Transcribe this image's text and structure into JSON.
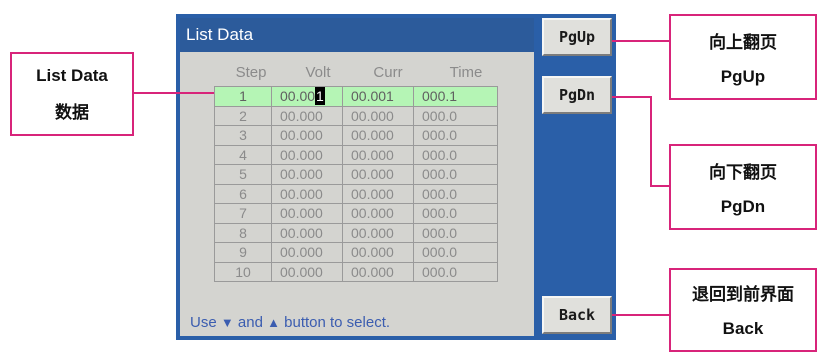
{
  "screen": {
    "title": "List Data",
    "headers": [
      "Step",
      "Volt",
      "Curr",
      "Time"
    ],
    "rows": [
      {
        "step": "1",
        "volt_a": "00.00",
        "volt_cursor": "1",
        "curr": "00.001",
        "time": "000.1"
      },
      {
        "step": "2",
        "volt": "00.000",
        "curr": "00.000",
        "time": "000.0"
      },
      {
        "step": "3",
        "volt": "00.000",
        "curr": "00.000",
        "time": "000.0"
      },
      {
        "step": "4",
        "volt": "00.000",
        "curr": "00.000",
        "time": "000.0"
      },
      {
        "step": "5",
        "volt": "00.000",
        "curr": "00.000",
        "time": "000.0"
      },
      {
        "step": "6",
        "volt": "00.000",
        "curr": "00.000",
        "time": "000.0"
      },
      {
        "step": "7",
        "volt": "00.000",
        "curr": "00.000",
        "time": "000.0"
      },
      {
        "step": "8",
        "volt": "00.000",
        "curr": "00.000",
        "time": "000.0"
      },
      {
        "step": "9",
        "volt": "00.000",
        "curr": "00.000",
        "time": "000.0"
      },
      {
        "step": "10",
        "volt": "00.000",
        "curr": "00.000",
        "time": "000.0"
      }
    ],
    "hint_pre": "Use ",
    "hint_mid": " and ",
    "hint_post": " button to select.",
    "hint_down_icon": "chevron-down-icon",
    "hint_up_icon": "chevron-up-icon"
  },
  "buttons": {
    "pgup": "PgUp",
    "pgdn": "PgDn",
    "back": "Back"
  },
  "callouts": {
    "list_data": {
      "line1": "List Data",
      "line2": "数据"
    },
    "pgup": {
      "line1": "向上翻页",
      "line2": "PgUp"
    },
    "pgdn": {
      "line1": "向下翻页",
      "line2": "PgDn"
    },
    "back": {
      "line1": "退回到前界面",
      "line2": "Back"
    }
  },
  "colors": {
    "callout_border": "#d8247a",
    "screen_blue": "#2a5fa8",
    "active_row": "#b5f5b5"
  }
}
